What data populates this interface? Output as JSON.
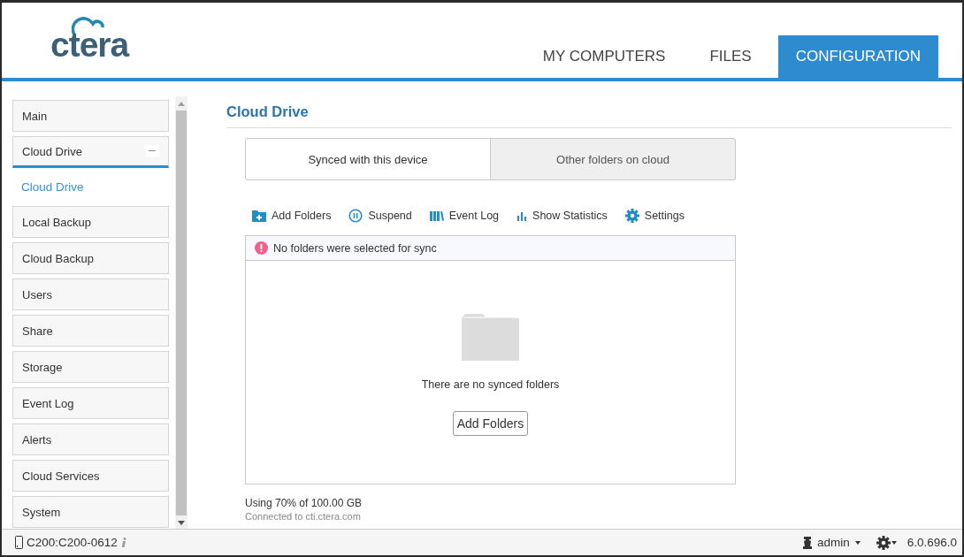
{
  "header": {
    "logo": "ctera",
    "tabs": [
      {
        "label": "MY COMPUTERS",
        "selected": false
      },
      {
        "label": "FILES",
        "selected": false
      },
      {
        "label": "CONFIGURATION",
        "selected": true
      }
    ]
  },
  "sidebar": {
    "items": [
      {
        "label": "Main"
      },
      {
        "label": "Cloud Drive",
        "expanded": true,
        "children": [
          {
            "label": "Cloud Drive",
            "selected": true
          }
        ]
      },
      {
        "label": "Local Backup"
      },
      {
        "label": "Cloud Backup"
      },
      {
        "label": "Users"
      },
      {
        "label": "Share"
      },
      {
        "label": "Storage"
      },
      {
        "label": "Event Log"
      },
      {
        "label": "Alerts"
      },
      {
        "label": "Cloud Services"
      },
      {
        "label": "System"
      }
    ]
  },
  "content": {
    "title": "Cloud Drive",
    "segments": [
      {
        "label": "Synced with this device",
        "selected": true
      },
      {
        "label": "Other folders on cloud",
        "selected": false
      }
    ],
    "toolbar": [
      {
        "label": "Add Folders",
        "kind": "add"
      },
      {
        "label": "Suspend",
        "kind": "suspend"
      },
      {
        "label": "Event Log",
        "kind": "log"
      },
      {
        "label": "Show Statistics",
        "kind": "stats"
      },
      {
        "label": "Settings",
        "kind": "settings"
      }
    ],
    "notice": "No folders were selected for sync",
    "empty_text": "There are no synced folders",
    "empty_button": "Add Folders",
    "usage": "Using 70% of 100.00 GB",
    "connection": "Connected to cti.ctera.com"
  },
  "status_bar": {
    "device": "C200:C200-0612",
    "user": "admin",
    "version": "6.0.696.0"
  }
}
